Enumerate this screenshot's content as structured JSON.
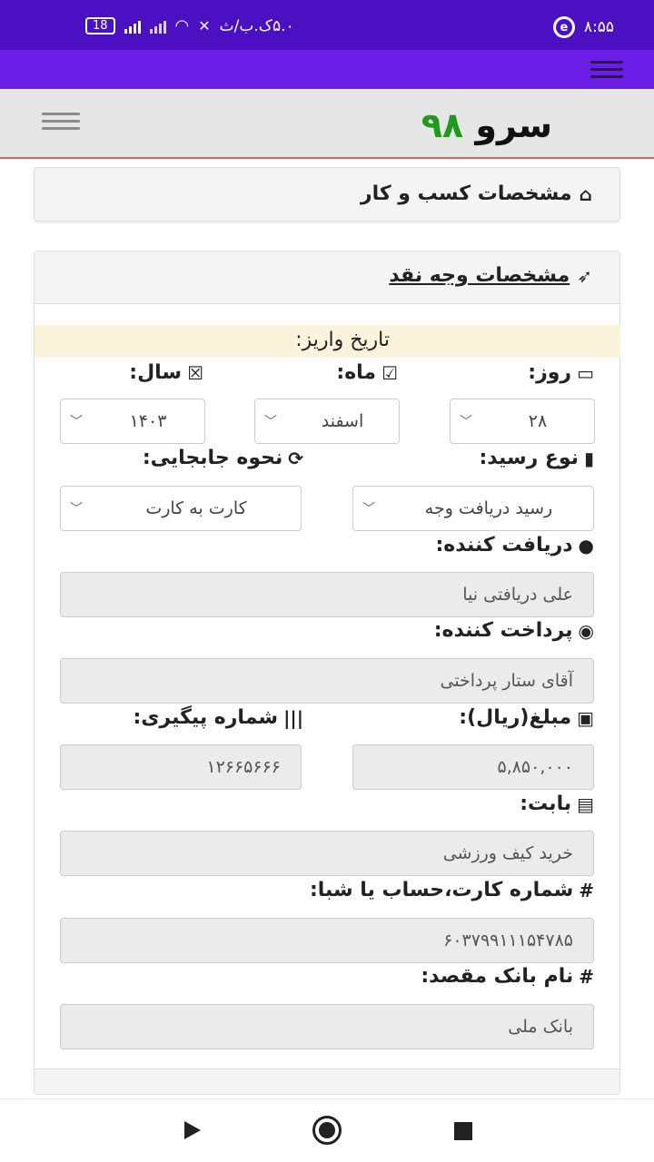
{
  "status_bar": {
    "time": "۸:۵۵",
    "carrier_text": "۵.۰ک.ب/ث",
    "battery": "18"
  },
  "header": {
    "logo_word": "سرو",
    "logo_number": "۹۸"
  },
  "business_card": {
    "title": "مشخصات کسب و کار",
    "icon": "home-icon"
  },
  "cash_card": {
    "title": "مشخصات وجه نقد",
    "icon": "rocket-icon",
    "deposit_date_label": "تاریخ واریز:",
    "day": {
      "label": "روز:",
      "value": "۲۸"
    },
    "month": {
      "label": "ماه:",
      "value": "اسفند"
    },
    "year": {
      "label": "سال:",
      "value": "۱۴۰۳"
    },
    "receipt_type": {
      "label": "نوع رسید:",
      "value": "رسید دریافت وجه"
    },
    "transfer_method": {
      "label": "نحوه جابجایی:",
      "value": "کارت به کارت"
    },
    "receiver": {
      "label": "دریافت کننده:",
      "value": "علی دریافتی نیا"
    },
    "payer": {
      "label": "پرداخت کننده:",
      "value": "آقای ستار پرداختی"
    },
    "amount": {
      "label": "مبلغ(ریال):",
      "value": "۵,۸۵۰,۰۰۰"
    },
    "tracking": {
      "label": "شماره پیگیری:",
      "value": "۱۲۶۶۵۶۶۶"
    },
    "purpose": {
      "label": "بابت:",
      "value": "خرید کیف ورزشی"
    },
    "account": {
      "label": "شماره کارت،حساب یا شبا:",
      "value": "۶۰۳۷۹۹۱۱۱۵۴۷۸۵"
    },
    "bank": {
      "label": "نام بانک مقصد:",
      "value": "بانک ملی"
    }
  },
  "colors": {
    "status_bar": "#4a10c2",
    "nav_bar": "#6a1ee6",
    "logo_number": "#1f9a1f",
    "header_bg": "#e6e6e6"
  }
}
